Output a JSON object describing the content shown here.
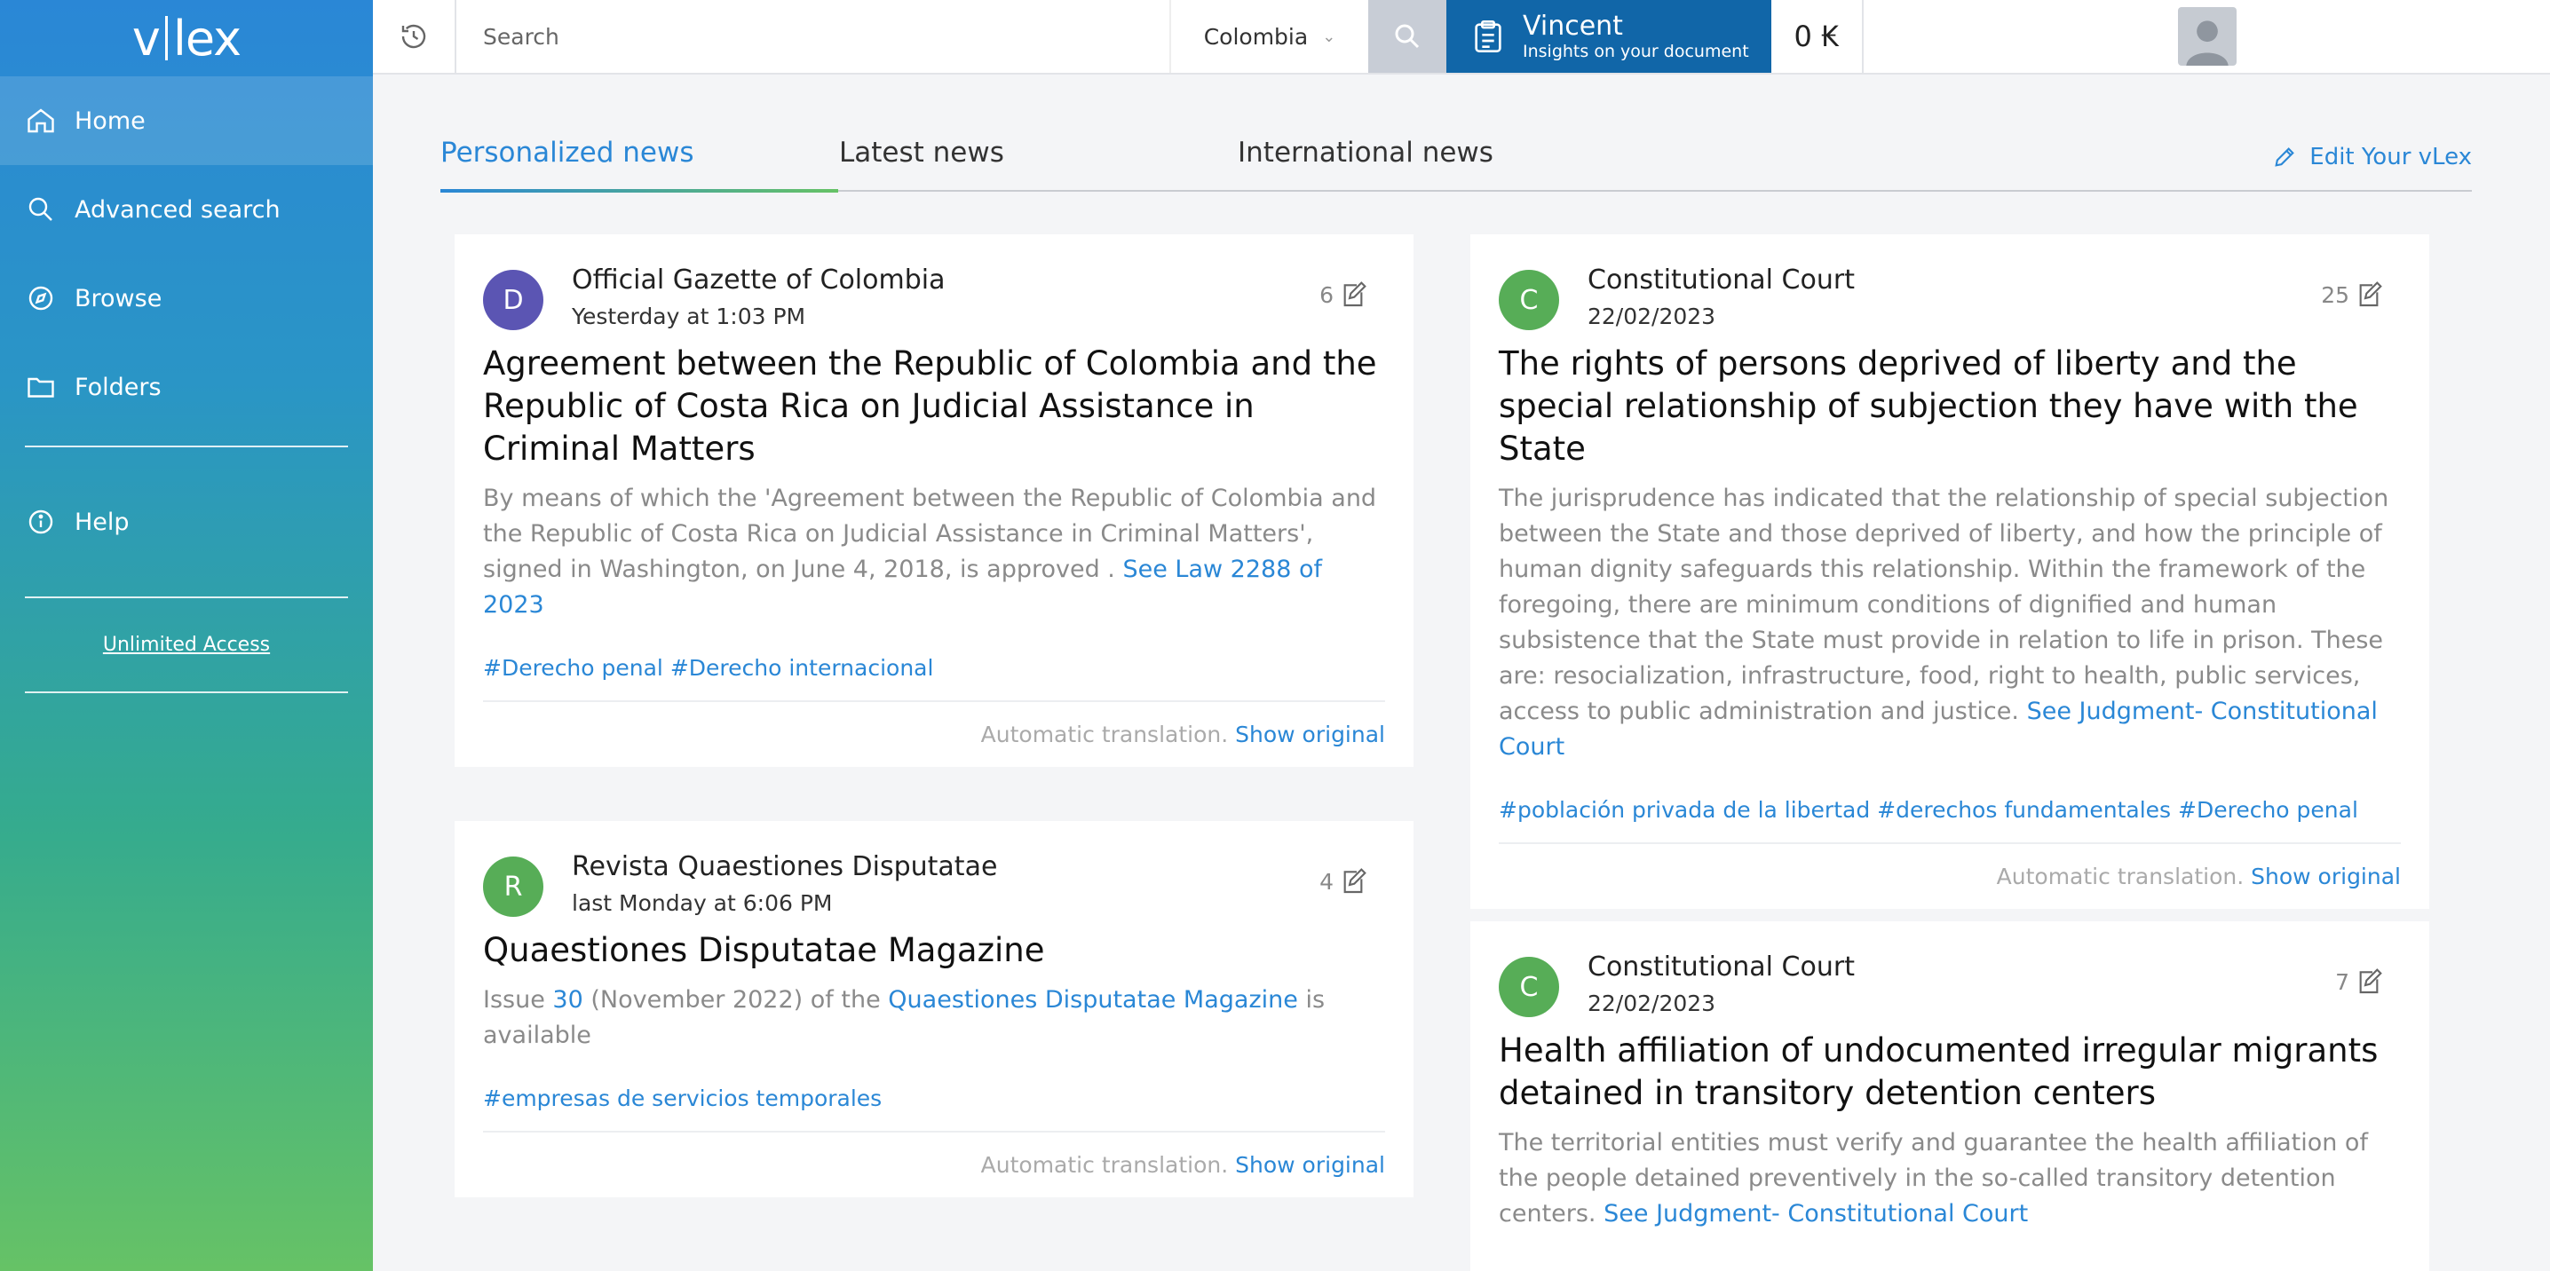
{
  "sidebar": {
    "logo_left": "v",
    "logo_right": "lex",
    "items": [
      {
        "label": "Home"
      },
      {
        "label": "Advanced search"
      },
      {
        "label": "Browse"
      },
      {
        "label": "Folders"
      }
    ],
    "help_label": "Help",
    "unlimited_label": "Unlimited Access"
  },
  "topbar": {
    "search_placeholder": "Search",
    "country": "Colombia",
    "vincent_title": "Vincent",
    "vincent_subtitle": "Insights on your document",
    "credits": "0 ₭"
  },
  "tabs": [
    {
      "label": "Personalized news"
    },
    {
      "label": "Latest news"
    },
    {
      "label": "International news"
    }
  ],
  "edit_label": "Edit Your vLex",
  "colors": {
    "accent": "#2a87d6",
    "purple_badge": "#5b55b3",
    "green_badge": "#57ad57",
    "vincent": "#1166a8"
  },
  "cards": [
    {
      "badge": "D",
      "source": "Official Gazette of Colombia",
      "date": "Yesterday at 1:03 PM",
      "count": "6",
      "title": "Agreement between the Republic of Colombia and the Republic of Costa Rica on Judicial Assistance in Criminal Matters",
      "summary": "By means of which the 'Agreement between the Republic of Colombia and the Republic of Costa Rica on Judicial Assistance in Criminal Matters', signed in Washington, on June 4, 2018, is approved .",
      "link": "See Law 2288 of 2023",
      "tags": [
        "#Derecho penal",
        "#Derecho internacional"
      ],
      "footer_text": "Automatic translation.",
      "footer_link": "Show original"
    },
    {
      "badge": "R",
      "source": "Revista Quaestiones Disputatae",
      "date": "last Monday at 6:06 PM",
      "count": "4",
      "title": "Quaestiones Disputatae Magazine",
      "summary_a": "Issue",
      "summary_link1": "30",
      "summary_b": "(November 2022) of the",
      "summary_link2": "Quaestiones Disputatae Magazine",
      "summary_c": "is available",
      "tags": [
        "#empresas de servicios temporales"
      ],
      "footer_text": "Automatic translation.",
      "footer_link": "Show original"
    },
    {
      "badge": "C",
      "source": "Constitutional Court",
      "date": "22/02/2023",
      "count": "25",
      "title": "The rights of persons deprived of liberty and the special relationship of subjection they have with the State",
      "summary": "The jurisprudence has indicated that the relationship of special subjection between the State and those deprived of liberty, and how the principle of human dignity safeguards this relationship. Within the framework of the foregoing, there are minimum conditions of dignified and human subsistence that the State must provide in relation to life in prison. These are: resocialization, infrastructure, food, right to health, public services, access to public administration and justice.",
      "link": "See Judgment- Constitutional Court",
      "tags": [
        "#población privada de la libertad",
        "#derechos fundamentales",
        "#Derecho penal"
      ],
      "footer_text": "Automatic translation.",
      "footer_link": "Show original"
    },
    {
      "badge": "C",
      "source": "Constitutional Court",
      "date": "22/02/2023",
      "count": "7",
      "title": "Health affiliation of undocumented irregular migrants detained in transitory detention centers",
      "summary": "The territorial entities must verify and guarantee the health affiliation of the people detained preventively in the so-called transitory detention centers.",
      "link": "See Judgment- Constitutional Court"
    }
  ]
}
